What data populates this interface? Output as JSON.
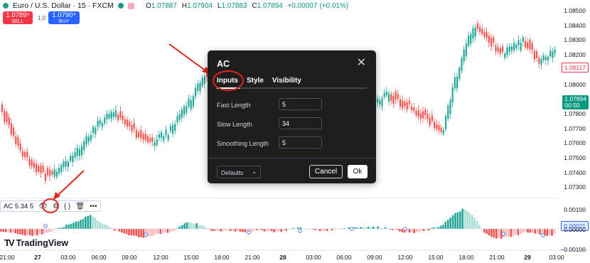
{
  "header": {
    "symbol": "Euro / U.S. Dollar · 15 · FXCM",
    "ohlc": [
      {
        "label": "O",
        "value": "1.07887"
      },
      {
        "label": "H",
        "value": "1.07904"
      },
      {
        "label": "L",
        "value": "1.07883"
      },
      {
        "label": "C",
        "value": "1.07894"
      },
      {
        "label": "",
        "value": "+0.00007 (+0.01%)"
      }
    ]
  },
  "trade": {
    "sell_price": "1.0789⁴",
    "sell_label": "SELL",
    "spread": "1.0",
    "buy_price": "1.0790⁴",
    "buy_label": "BUY"
  },
  "price_axis": [
    "1.08500",
    "1.08400",
    "1.08300",
    "1.08200",
    "1.08100",
    "1.08000",
    "1.07900",
    "1.07800",
    "1.07700",
    "1.07600",
    "1.07500",
    "1.07400",
    "1.07300"
  ],
  "price_tags": {
    "red": "1.08117",
    "green_price": "1.07894",
    "green_time": "00:50",
    "indicator": "0.00021"
  },
  "indicator_axis": [
    "0.00100",
    "0.00000",
    "−0.00100"
  ],
  "time_axis": [
    {
      "label": "21:00",
      "bold": false
    },
    {
      "label": "27",
      "bold": true
    },
    {
      "label": "03:00",
      "bold": false
    },
    {
      "label": "06:00",
      "bold": false
    },
    {
      "label": "09:00",
      "bold": false
    },
    {
      "label": "12:00",
      "bold": false
    },
    {
      "label": "15:00",
      "bold": false
    },
    {
      "label": "18:00",
      "bold": false
    },
    {
      "label": "21:00",
      "bold": false
    },
    {
      "label": "28",
      "bold": true
    },
    {
      "label": "03:00",
      "bold": false
    },
    {
      "label": "06:00",
      "bold": false
    },
    {
      "label": "09:00",
      "bold": false
    },
    {
      "label": "12:00",
      "bold": false
    },
    {
      "label": "15:00",
      "bold": false
    },
    {
      "label": "18:00",
      "bold": false
    },
    {
      "label": "21:00",
      "bold": false
    },
    {
      "label": "29",
      "bold": true
    },
    {
      "label": "03:00",
      "bold": false
    }
  ],
  "indicator_legend": {
    "text": "AC 5 34 5",
    "icons": [
      "eye-icon",
      "settings-icon",
      "braces-icon",
      "trash-icon",
      "more-icon"
    ]
  },
  "brand": "TradingView",
  "dialog": {
    "title": "AC",
    "tabs": [
      "Inputs",
      "Style",
      "Visibility"
    ],
    "active_tab": "Inputs",
    "fields": [
      {
        "label": "Fast Length",
        "value": "5"
      },
      {
        "label": "Slow Length",
        "value": "34"
      },
      {
        "label": "Smoothing Length",
        "value": "5"
      }
    ],
    "defaults_label": "Defaults",
    "cancel_label": "Cancel",
    "ok_label": "Ok"
  },
  "colors": {
    "up": "#26a69a",
    "down": "#ef5350",
    "annotation": "#e1251b"
  }
}
